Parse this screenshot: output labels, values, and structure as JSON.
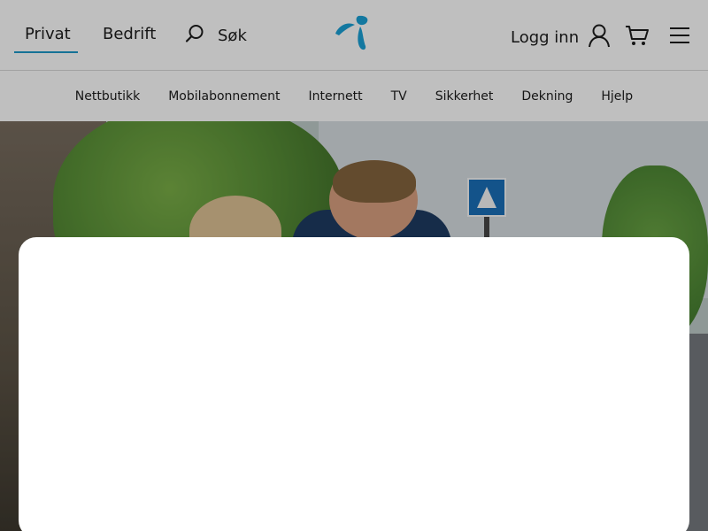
{
  "header": {
    "segments": [
      {
        "label": "Privat",
        "active": true
      },
      {
        "label": "Bedrift",
        "active": false
      }
    ],
    "search_label": "Søk",
    "login_label": "Logg inn",
    "icons": {
      "search": "search-icon",
      "logo": "telenor-logo",
      "user": "user-icon",
      "cart": "cart-icon",
      "menu": "hamburger-menu-icon"
    },
    "colors": {
      "accent": "#1d98c9",
      "logo": "#1aa0d6"
    }
  },
  "subnav": {
    "items": [
      {
        "label": "Nettbutikk"
      },
      {
        "label": "Mobilabonnement"
      },
      {
        "label": "Internett"
      },
      {
        "label": "TV"
      },
      {
        "label": "Sikkerhet"
      },
      {
        "label": "Dekning"
      },
      {
        "label": "Hjelp"
      }
    ]
  },
  "hero": {
    "image": "family-outdoor-photo"
  },
  "modal": {
    "state": "open-empty"
  }
}
